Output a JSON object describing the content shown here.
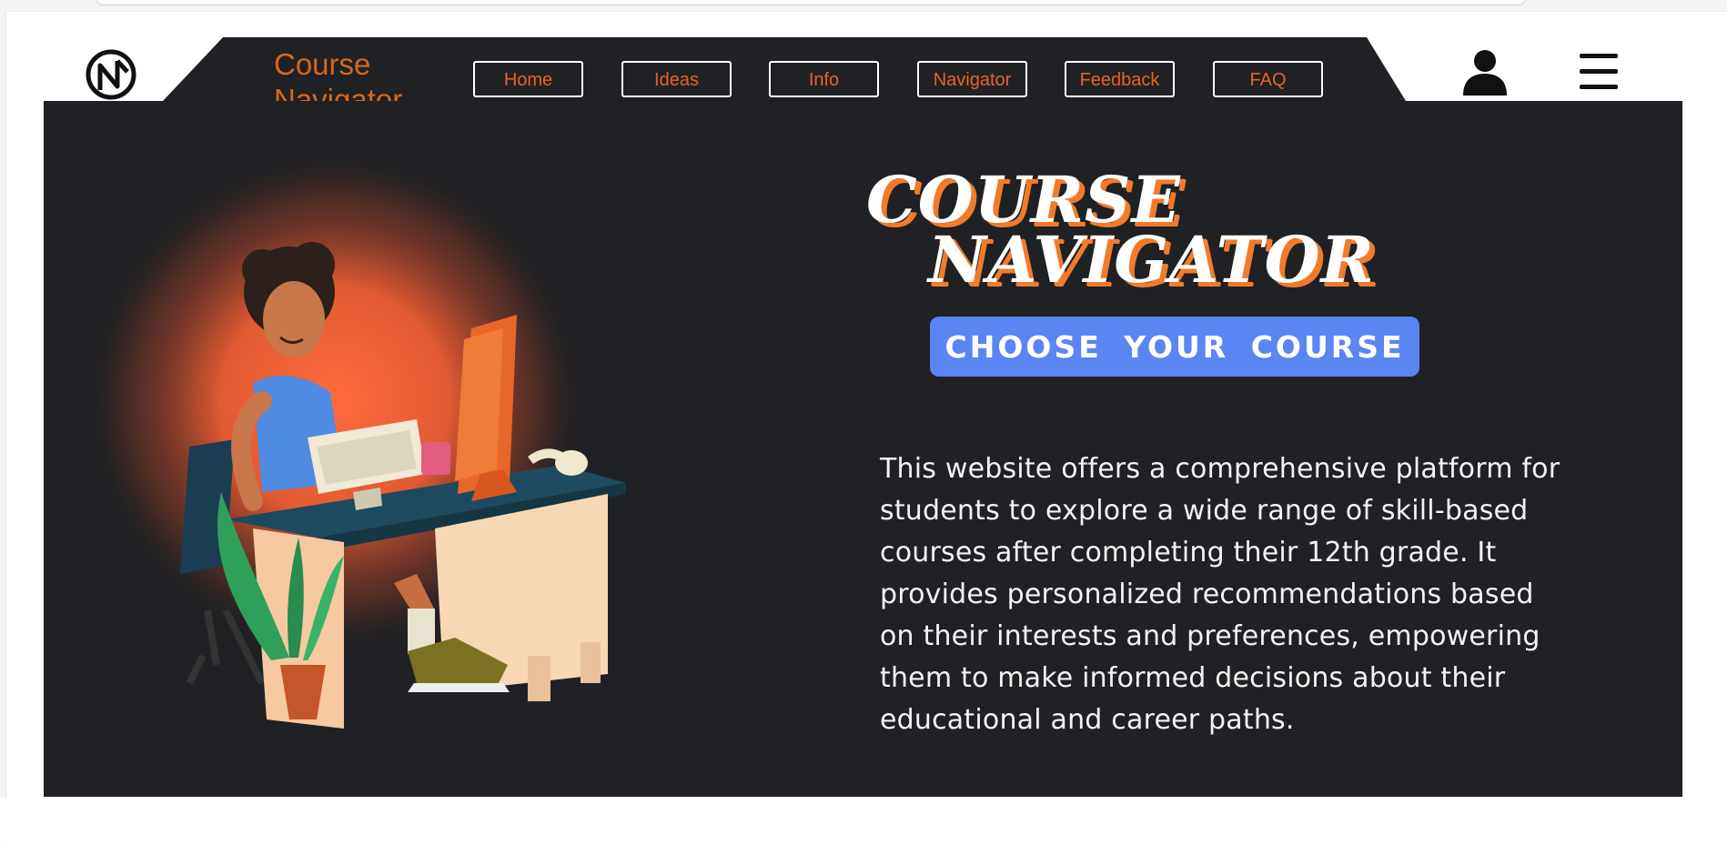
{
  "app": {
    "brand_line1": "Course",
    "brand_line2": "Navigator",
    "logo_icon": "cn-monogram-icon"
  },
  "nav": {
    "items": [
      {
        "label": "Home"
      },
      {
        "label": "Ideas"
      },
      {
        "label": "Info"
      },
      {
        "label": "Navigator"
      },
      {
        "label": "Feedback"
      },
      {
        "label": "FAQ"
      }
    ]
  },
  "header_icons": {
    "user": "user-icon",
    "menu": "hamburger-menu-icon"
  },
  "hero": {
    "title_line1": "COURSE",
    "title_line2": "NAVIGATOR",
    "cta_label": "CHOOSE YOUR COURSE",
    "description": "This website offers a comprehensive platform for students to explore a wide range of skill-based courses after completing their 12th grade. It provides personalized recommendations based on their interests and preferences, empowering them to make informed decisions about their educational and career paths.",
    "illustration": "student-at-desk-illustration"
  },
  "colors": {
    "brand_orange": "#d5661d",
    "nav_text": "#e3622b",
    "hero_bg": "#1f2124",
    "cta_blue": "#5a85f2",
    "title_shadow": "#f27b2a"
  }
}
